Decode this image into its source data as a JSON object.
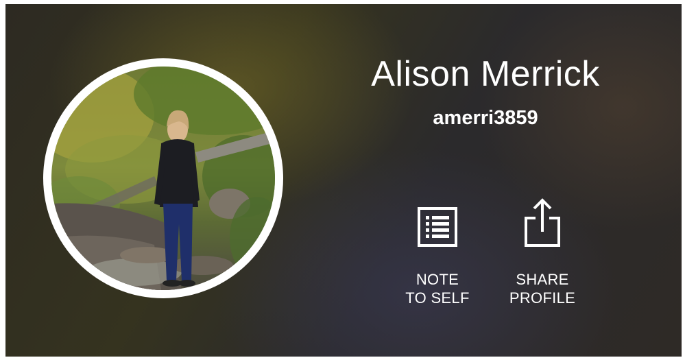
{
  "profile": {
    "name": "Alison Merrick",
    "username": "amerri3859",
    "avatar_icon": "profile-photo"
  },
  "actions": [
    {
      "id": "note-to-self",
      "label": "NOTE\nTO SELF",
      "icon": "note-list-icon"
    },
    {
      "id": "share-profile",
      "label": "SHARE\nPROFILE",
      "icon": "share-icon"
    }
  ],
  "colors": {
    "text": "#ffffff",
    "avatar_ring": "#ffffff"
  }
}
